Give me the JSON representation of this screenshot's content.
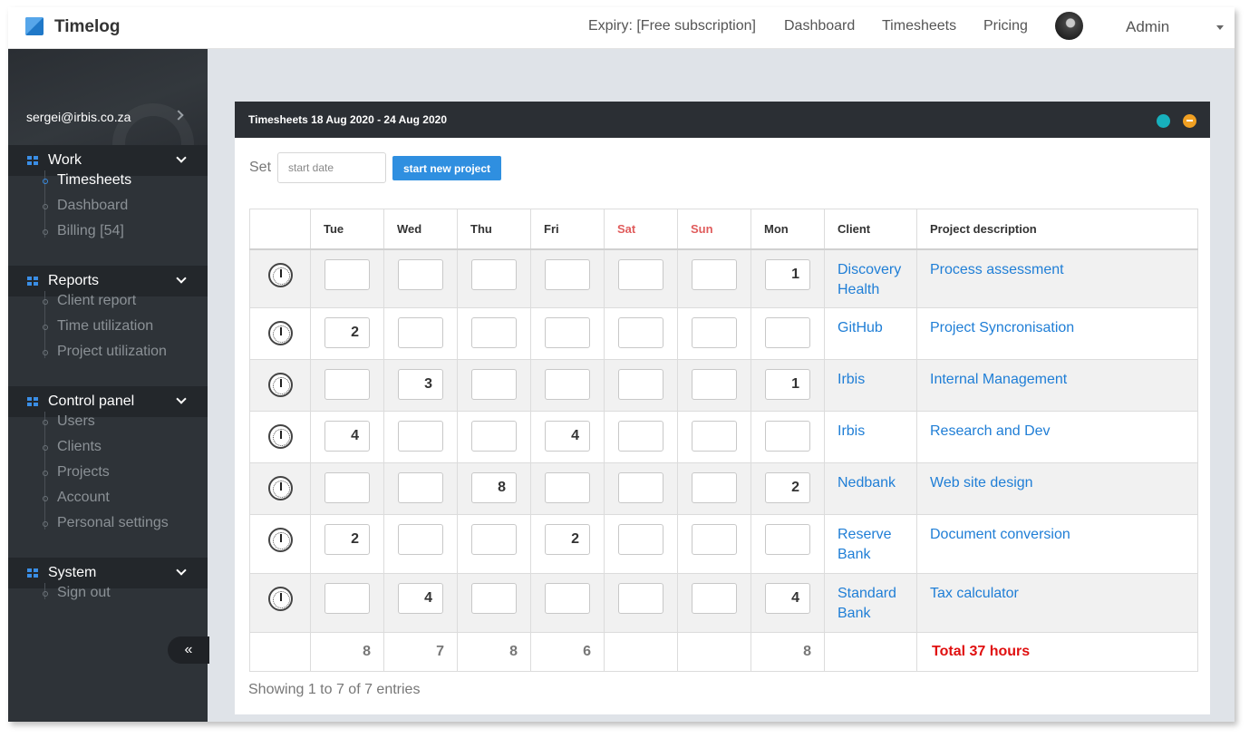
{
  "app": {
    "name": "Timelog"
  },
  "topnav": {
    "expiry": "Expiry: [Free subscription]",
    "dashboard": "Dashboard",
    "timesheets": "Timesheets",
    "pricing": "Pricing",
    "user": "Admin"
  },
  "sidebar": {
    "email": "sergei@irbis.co.za",
    "sections": [
      {
        "label": "Work",
        "items": [
          {
            "label": "Timesheets",
            "active": true
          },
          {
            "label": "Dashboard"
          },
          {
            "label": "Billing [54]"
          }
        ]
      },
      {
        "label": "Reports",
        "items": [
          {
            "label": "Client report"
          },
          {
            "label": "Time utilization"
          },
          {
            "label": "Project utilization"
          }
        ]
      },
      {
        "label": "Control panel",
        "items": [
          {
            "label": "Users"
          },
          {
            "label": "Clients"
          },
          {
            "label": "Projects"
          },
          {
            "label": "Account"
          },
          {
            "label": "Personal settings"
          }
        ]
      },
      {
        "label": "System",
        "items": [
          {
            "label": "Sign out"
          }
        ]
      }
    ],
    "collapse_label": "«"
  },
  "panel": {
    "title": "Timesheets 18 Aug 2020 - 24 Aug 2020",
    "set_label": "Set",
    "date_placeholder": "start date",
    "new_project_button": "start new project"
  },
  "table": {
    "columns": [
      "",
      "Tue",
      "Wed",
      "Thu",
      "Fri",
      "Sat",
      "Sun",
      "Mon",
      "Client",
      "Project description"
    ],
    "weekend_columns": [
      "Sat",
      "Sun"
    ],
    "rows": [
      {
        "client": "Discovery Health",
        "project": "Process assessment",
        "hours": [
          "",
          "",
          "",
          "",
          "",
          "",
          "1"
        ]
      },
      {
        "client": "GitHub",
        "project": "Project Syncronisation",
        "hours": [
          "2",
          "",
          "",
          "",
          "",
          "",
          ""
        ]
      },
      {
        "client": "Irbis",
        "project": "Internal Management",
        "hours": [
          "",
          "3",
          "",
          "",
          "",
          "",
          "1"
        ]
      },
      {
        "client": "Irbis",
        "project": "Research and Dev",
        "hours": [
          "4",
          "",
          "",
          "4",
          "",
          "",
          ""
        ]
      },
      {
        "client": "Nedbank",
        "project": "Web site design",
        "hours": [
          "",
          "",
          "8",
          "",
          "",
          "",
          "2"
        ]
      },
      {
        "client": "Reserve Bank",
        "project": "Document conversion",
        "hours": [
          "2",
          "",
          "",
          "2",
          "",
          "",
          ""
        ]
      },
      {
        "client": "Standard Bank",
        "project": "Tax calculator",
        "hours": [
          "",
          "4",
          "",
          "",
          "",
          "",
          "4"
        ]
      }
    ],
    "totals": [
      "8",
      "7",
      "8",
      "6",
      "",
      "",
      "8"
    ],
    "total_label": "Total 37 hours"
  },
  "footer": {
    "showing": "Showing 1 to 7 of 7 entries"
  },
  "colors": {
    "accent": "#2f8fe0",
    "link": "#1f7ed6",
    "weekend": "#e05c5c",
    "total": "#e01010",
    "sidebar": "#2e3338"
  }
}
